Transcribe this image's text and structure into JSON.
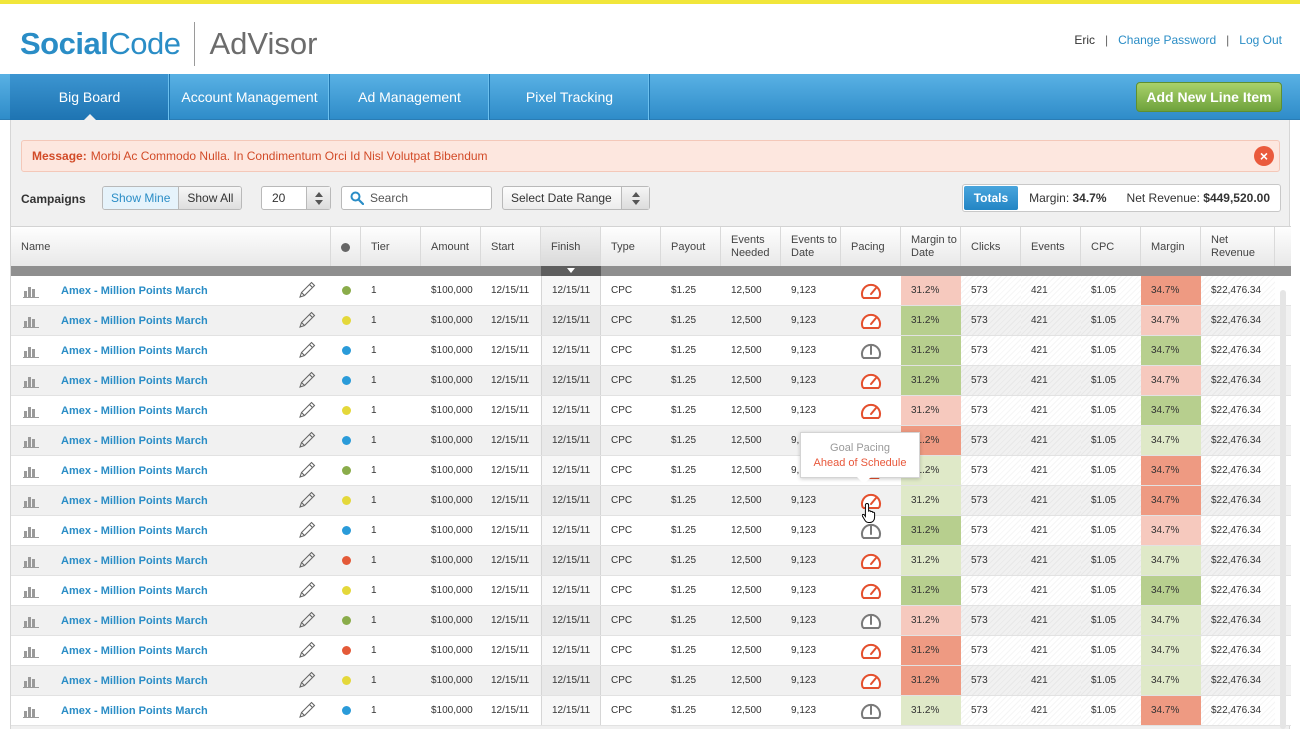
{
  "brand": {
    "social": "Social",
    "code": "Code",
    "advisor": "AdVisor",
    "accent": "#2a8dc6"
  },
  "user": {
    "name": "Eric",
    "change_password": "Change Password",
    "logout": "Log Out",
    "sep": "|"
  },
  "nav": {
    "tabs": [
      "Big Board",
      "Account Management",
      "Ad Management",
      "Pixel Tracking"
    ],
    "active": "Big Board",
    "add_button": "Add New Line Item"
  },
  "message": {
    "label": "Message:",
    "text": "Morbi Ac Commodo Nulla. In Condimentum Orci Id Nisl Volutpat Bibendum",
    "close": "×"
  },
  "toolbar": {
    "campaigns_label": "Campaigns",
    "show_mine": "Show Mine",
    "show_all": "Show All",
    "per_page": "20",
    "search_placeholder": "Search",
    "date_range": "Select Date Range",
    "totals_label": "Totals",
    "margin_label": "Margin:",
    "margin_value": "34.7%",
    "net_revenue_label": "Net Revenue:",
    "net_revenue_value": "$449,520.00"
  },
  "table": {
    "columns": [
      "Name",
      "Tier",
      "Amount",
      "Start",
      "Finish",
      "Type",
      "Payout",
      "Events Needed",
      "Events to Date",
      "Pacing",
      "Margin to Date",
      "Clicks",
      "Events",
      "CPC",
      "Margin",
      "Net Revenue"
    ],
    "sorted_column": "Finish",
    "row_defaults": {
      "name": "Amex - Million Points March",
      "tier": "1",
      "amount": "$100,000",
      "start": "12/15/11",
      "finish": "12/15/11",
      "type": "CPC",
      "payout": "$1.25",
      "events_needed": "12,500",
      "events_to_date": "9,123",
      "margin_to_date": "31.2%",
      "clicks": "573",
      "events": "421",
      "cpc": "$1.05",
      "margin": "34.7%",
      "net_revenue": "$22,476.34"
    },
    "status_colors": {
      "green": "#8aac4a",
      "yellow": "#e4d83a",
      "blue": "#2a9bd9",
      "red": "#e45a38"
    },
    "cell_colors": {
      "pink": "#f6c9be",
      "green": "#b7cf8e",
      "lightgreen": "#dfe9c8",
      "red": "#ee9a82"
    },
    "rows": [
      {
        "status": "green",
        "pacing": "red",
        "mtd": "pink",
        "margin": "red"
      },
      {
        "status": "yellow",
        "pacing": "red",
        "mtd": "green",
        "margin": "pink"
      },
      {
        "status": "blue",
        "pacing": "gray",
        "mtd": "green",
        "margin": "green"
      },
      {
        "status": "blue",
        "pacing": "red",
        "mtd": "green",
        "margin": "pink"
      },
      {
        "status": "yellow",
        "pacing": "red",
        "mtd": "pink",
        "margin": "green"
      },
      {
        "status": "blue",
        "pacing": "red",
        "mtd": "red",
        "margin": "lightgreen"
      },
      {
        "status": "green",
        "pacing": "red",
        "mtd": "lightgreen",
        "margin": "red"
      },
      {
        "status": "yellow",
        "pacing": "red",
        "mtd": "lightgreen",
        "margin": "red"
      },
      {
        "status": "blue",
        "pacing": "gray",
        "mtd": "green",
        "margin": "pink"
      },
      {
        "status": "red",
        "pacing": "red",
        "mtd": "lightgreen",
        "margin": "lightgreen"
      },
      {
        "status": "yellow",
        "pacing": "red",
        "mtd": "green",
        "margin": "green"
      },
      {
        "status": "green",
        "pacing": "gray",
        "mtd": "pink",
        "margin": "lightgreen"
      },
      {
        "status": "red",
        "pacing": "red",
        "mtd": "red",
        "margin": "lightgreen"
      },
      {
        "status": "yellow",
        "pacing": "red",
        "mtd": "red",
        "margin": "lightgreen"
      },
      {
        "status": "blue",
        "pacing": "gray",
        "mtd": "lightgreen",
        "margin": "red"
      }
    ]
  },
  "tooltip": {
    "title": "Goal Pacing",
    "status": "Ahead of Schedule"
  },
  "icons": {
    "row_chart": "bar-chart-icon",
    "row_edit": "pencil-icon",
    "pacing": "gauge-icon",
    "search": "search-icon"
  }
}
